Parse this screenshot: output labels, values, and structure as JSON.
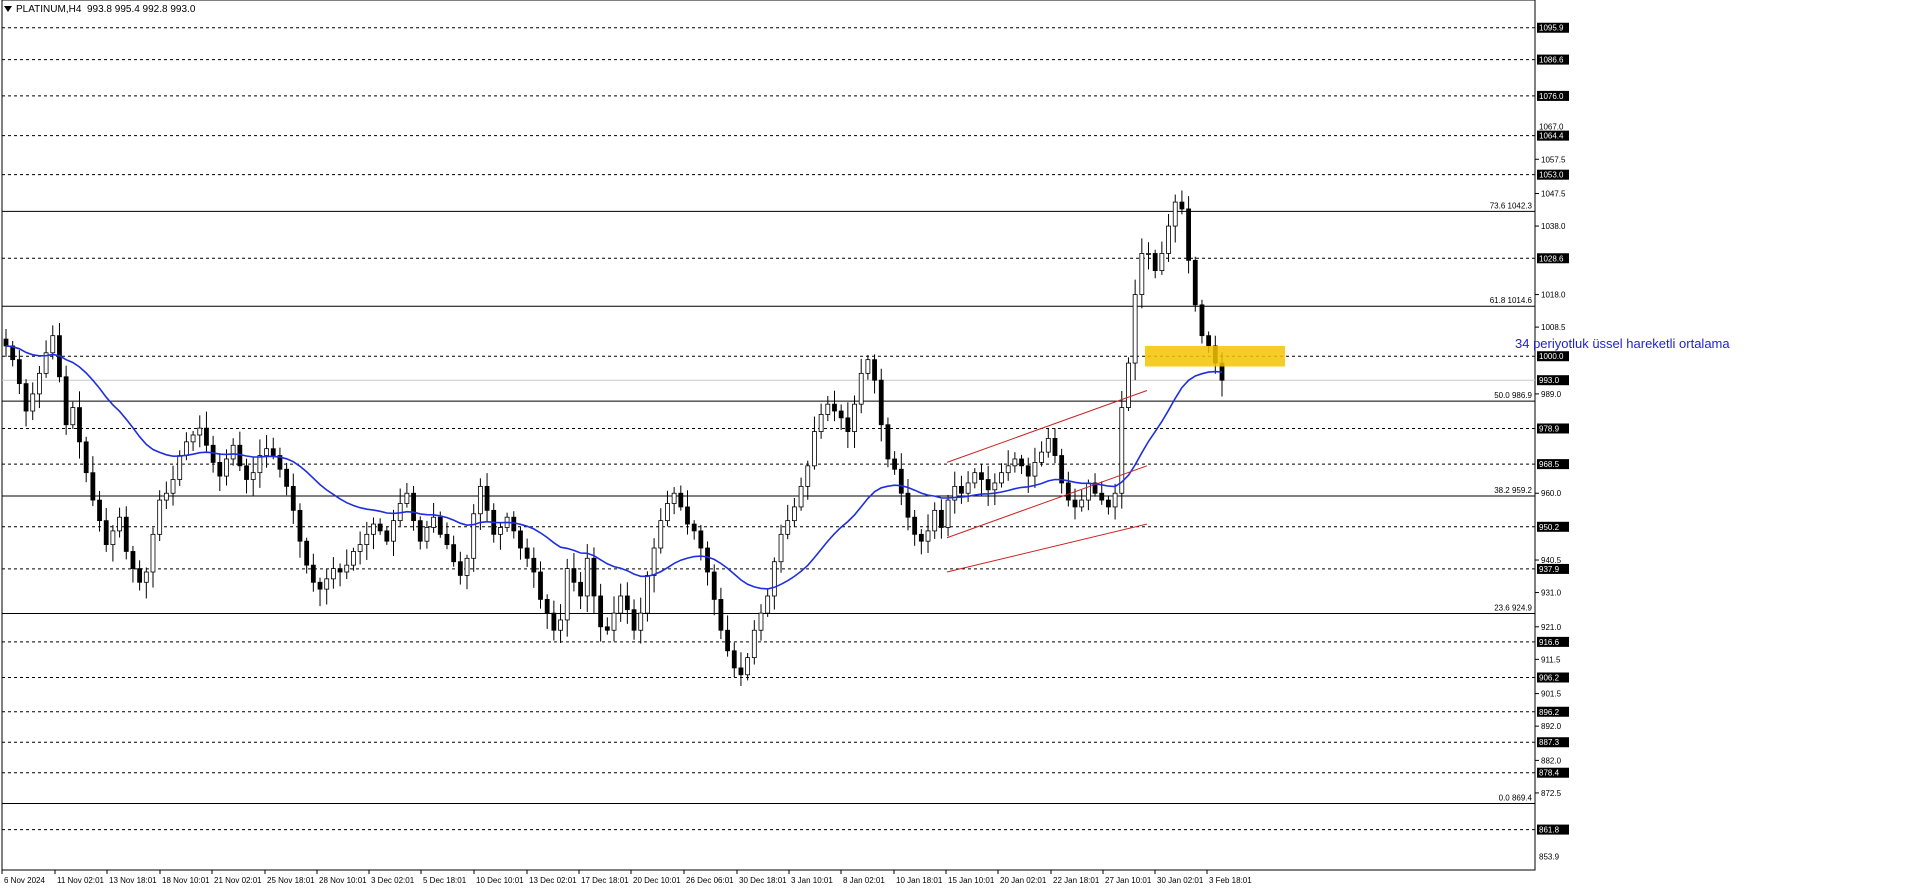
{
  "header": {
    "symbol": "PLATINUM,H4",
    "ohlc": "993.8 995.4 992.8 993.0"
  },
  "annotation": {
    "text": "34 periyotluk üssel hareketli ortalama"
  },
  "colors": {
    "candle": "#000000",
    "ema": "#1f2fe0",
    "channel": "#cc2222",
    "highlight": "#f5c400",
    "level": "#000000",
    "grid": "#000000"
  },
  "chart_data": {
    "type": "candlestick",
    "ylim": [
      850.0,
      1104.0
    ],
    "x_tick_labels": [
      "6 Nov 2024",
      "11 Nov 02:01",
      "13 Nov 18:01",
      "18 Nov 10:01",
      "21 Nov 02:01",
      "25 Nov 18:01",
      "28 Nov 10:01",
      "3 Dec 02:01",
      "5 Dec 18:01",
      "10 Dec 10:01",
      "13 Dec 02:01",
      "17 Dec 18:01",
      "20 Dec 10:01",
      "26 Dec 06:01",
      "30 Dec 18:01",
      "3 Jan 10:01",
      "8 Jan 02:01",
      "10 Jan 18:01",
      "15 Jan 10:01",
      "20 Jan 02:01",
      "22 Jan 18:01",
      "27 Jan 10:01",
      "30 Jan 02:01",
      "3 Feb 18:01"
    ],
    "y_tick_labels": [
      1057.5,
      1047.5,
      1038.0,
      1018.0,
      1008.5,
      989.0,
      960.0,
      940.5,
      931.0,
      921.0,
      911.5,
      901.5,
      892.0,
      882.0,
      872.5
    ],
    "price_tags": [
      {
        "value": 1095.9,
        "label": "1095.9",
        "line": "dashed"
      },
      {
        "value": 1086.6,
        "label": "1086.6",
        "line": "dashed"
      },
      {
        "value": 1076.0,
        "label": "1076.0",
        "line": "dashed"
      },
      {
        "value": 1067.0,
        "label": "1067.0",
        "line": "none"
      },
      {
        "value": 1064.4,
        "label": "1064.4",
        "line": "dashed"
      },
      {
        "value": 1053.0,
        "label": "1053.0",
        "line": "dashed"
      },
      {
        "value": 1028.6,
        "label": "1028.6",
        "line": "dashed"
      },
      {
        "value": 1000.0,
        "label": "1000.0",
        "line": "dashed"
      },
      {
        "value": 993.0,
        "label": "993.0",
        "line": "current"
      },
      {
        "value": 978.9,
        "label": "978.9",
        "line": "dashed"
      },
      {
        "value": 968.5,
        "label": "968.5",
        "line": "dashed"
      },
      {
        "value": 950.2,
        "label": "950.2",
        "line": "dashed"
      },
      {
        "value": 937.9,
        "label": "937.9",
        "line": "dashed"
      },
      {
        "value": 916.6,
        "label": "916.6",
        "line": "dashed"
      },
      {
        "value": 906.2,
        "label": "906.2",
        "line": "dashed"
      },
      {
        "value": 896.2,
        "label": "896.2",
        "line": "dashed"
      },
      {
        "value": 887.3,
        "label": "887.3",
        "line": "dashed"
      },
      {
        "value": 878.4,
        "label": "878.4",
        "line": "dashed"
      },
      {
        "value": 861.8,
        "label": "861.8",
        "line": "dashed"
      },
      {
        "value": 853.9,
        "label": "853.9",
        "line": "none"
      }
    ],
    "fibonacci": [
      {
        "level": "73.6",
        "value": 1042.3,
        "label": "73.6 1042.3"
      },
      {
        "level": "61.8",
        "value": 1014.6,
        "label": "61.8 1014.6"
      },
      {
        "level": "50.0",
        "value": 986.9,
        "label": "50.0 986.9"
      },
      {
        "level": "38.2",
        "value": 959.2,
        "label": "38.2 959.2"
      },
      {
        "level": "23.6",
        "value": 924.9,
        "label": "23.6 924.9"
      },
      {
        "level": "0.0",
        "value": 869.4,
        "label": "0.0 869.4"
      }
    ],
    "closes": [
      1003,
      999,
      992,
      984,
      989,
      995,
      1001,
      1006,
      994,
      980,
      985,
      975,
      966,
      958,
      952,
      945,
      949,
      953,
      943,
      938,
      934,
      937,
      948,
      958,
      960,
      964,
      971,
      975,
      977,
      979,
      974,
      969,
      965,
      970,
      974,
      968,
      964,
      966,
      971,
      973,
      971,
      967,
      962,
      955,
      946,
      939,
      934,
      932,
      935,
      938,
      937,
      939,
      943,
      945,
      948,
      951,
      949,
      946,
      952,
      957,
      960,
      952,
      946,
      950,
      953,
      948,
      945,
      940,
      936,
      941,
      954,
      962,
      955,
      948,
      950,
      953,
      949,
      944,
      941,
      937,
      929,
      925,
      920,
      923,
      938,
      934,
      930,
      941,
      930,
      921,
      920,
      925,
      930,
      926,
      920,
      925,
      936,
      944,
      952,
      957,
      960,
      956,
      951,
      949,
      944,
      937,
      929,
      920,
      914,
      909,
      907,
      912,
      920,
      925,
      930,
      940,
      948,
      952,
      956,
      962,
      968,
      978,
      983,
      986,
      984,
      982,
      978,
      986,
      995,
      999,
      993,
      980,
      970,
      967,
      960,
      953,
      948,
      946,
      949,
      955,
      950,
      958,
      962,
      960,
      963,
      966,
      964,
      961,
      963,
      966,
      968,
      970,
      968,
      965,
      969,
      972,
      976,
      971,
      963,
      958,
      956,
      958,
      963,
      960,
      958,
      956,
      960,
      985,
      998,
      1018,
      1030,
      1030,
      1025,
      1030,
      1038,
      1045,
      1043,
      1028,
      1015,
      1006,
      1003,
      998,
      993
    ],
    "ema_label": "34 periyotluk üssel hareketli ortalama"
  }
}
